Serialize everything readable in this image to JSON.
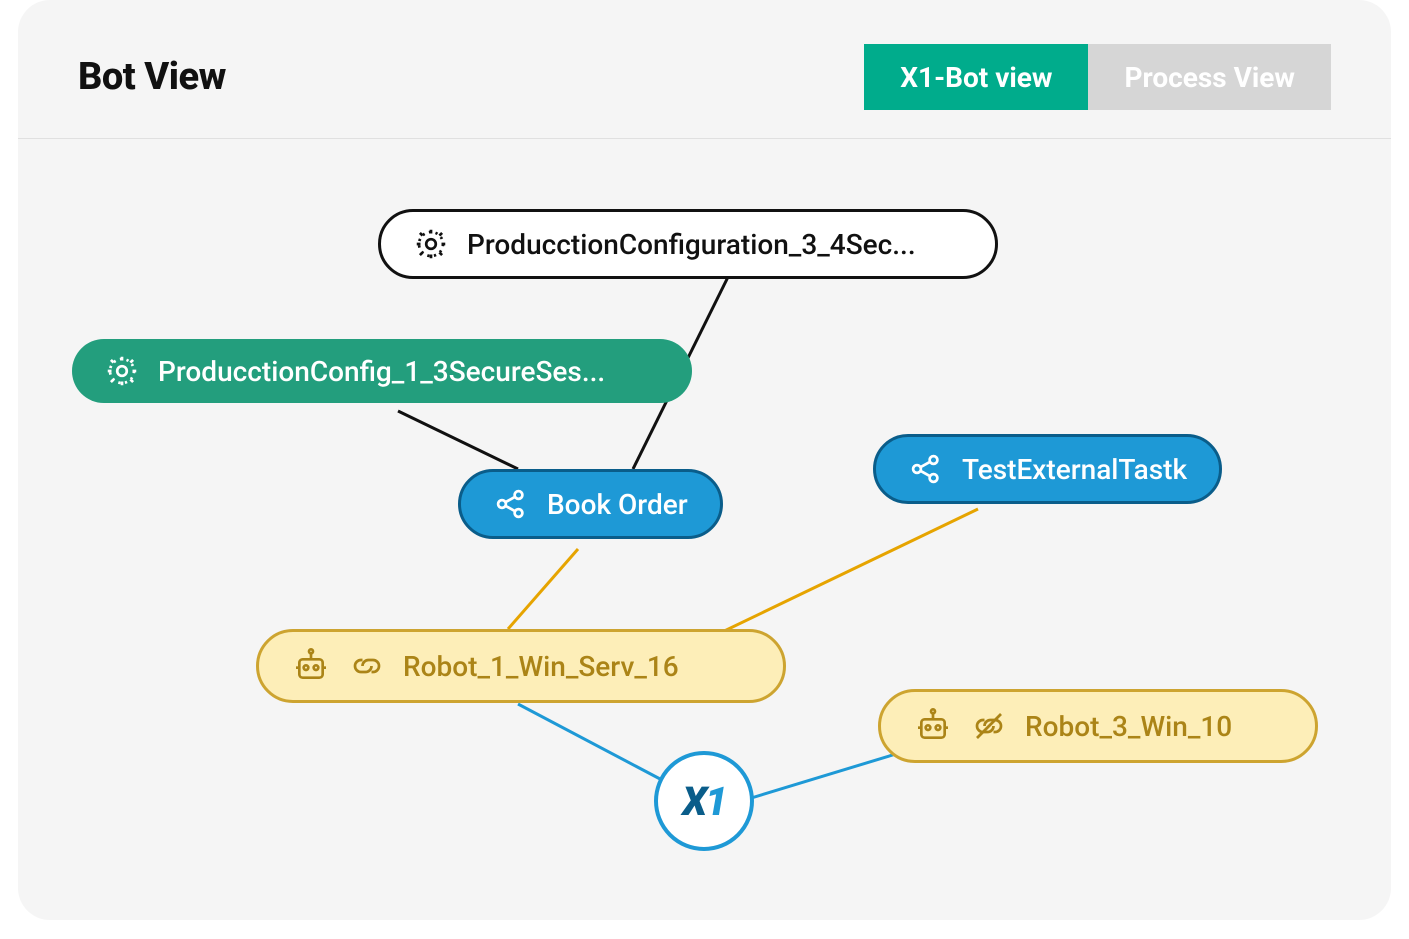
{
  "header": {
    "title": "Bot View",
    "tabs": [
      {
        "label": "X1-Bot view",
        "active": true
      },
      {
        "label": "Process View",
        "active": false
      }
    ]
  },
  "hub": {
    "logo_text_x": "X",
    "logo_text_1": "1"
  },
  "nodes": {
    "config3": {
      "label": "ProducctionConfiguration_3_4Sec...",
      "icon": "gear-icon"
    },
    "config1": {
      "label": "ProducctionConfig_1_3SecureSes...",
      "icon": "gear-icon"
    },
    "bookorder": {
      "label": "Book Order",
      "icon": "share-icon"
    },
    "externaltask": {
      "label": "TestExternalTastk",
      "icon": "share-icon"
    },
    "robot1": {
      "label": "Robot_1_Win_Serv_16",
      "icon": "robot-icon",
      "link": "linked"
    },
    "robot3": {
      "label": "Robot_3_Win_10",
      "icon": "robot-icon",
      "link": "unlinked"
    }
  },
  "edges": [
    {
      "from": "config3",
      "to": "bookorder",
      "color": "#111"
    },
    {
      "from": "config1",
      "to": "bookorder",
      "color": "#111"
    },
    {
      "from": "bookorder",
      "to": "robot1",
      "color": "#e6a400"
    },
    {
      "from": "externaltask",
      "to": "robot1",
      "color": "#e6a400"
    },
    {
      "from": "robot1",
      "to": "hub",
      "color": "#1e99d6"
    },
    {
      "from": "robot3",
      "to": "hub",
      "color": "#1e99d6"
    }
  ],
  "colors": {
    "accent_green": "#00ac8c",
    "node_green": "#239e7d",
    "node_blue": "#1e99d6",
    "node_blue_border": "#0a5d8a",
    "node_yellow": "#fdeeb8",
    "node_yellow_border": "#cda430",
    "edge_black": "#111111",
    "edge_orange": "#e6a400",
    "edge_blue": "#1e99d6"
  }
}
